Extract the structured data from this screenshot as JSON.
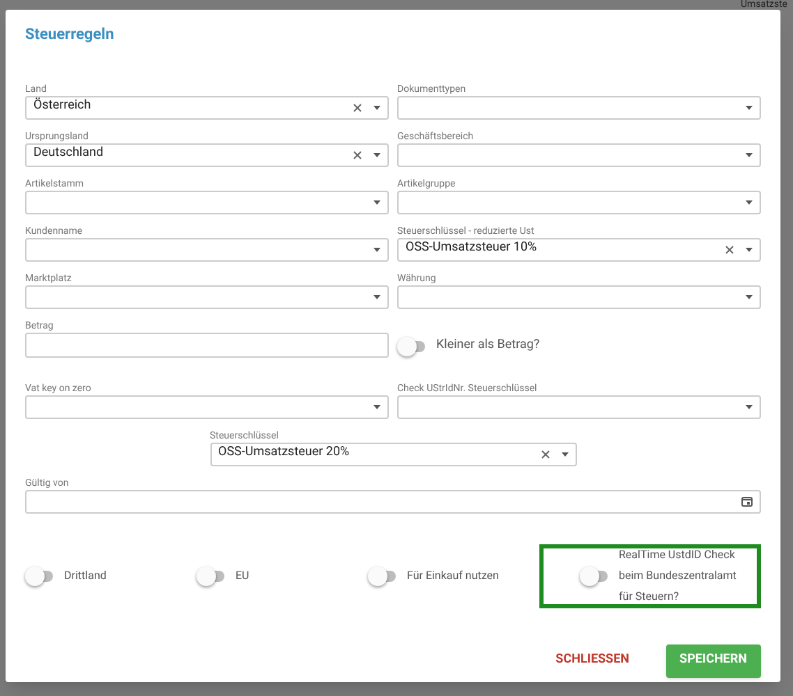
{
  "background_text": "Umsatzste",
  "title": "Steuerregeln",
  "sections": [
    {
      "rows": [
        [
          {
            "kind": "select",
            "label": "Land",
            "value": "Österreich",
            "clearable": true
          },
          {
            "kind": "select",
            "label": "Dokumenttypen",
            "clearable": false
          }
        ],
        [
          {
            "kind": "select",
            "label": "Ursprungsland",
            "value": "Deutschland",
            "clearable": true
          },
          {
            "kind": "select",
            "label": "Geschäftsbereich",
            "clearable": false
          }
        ],
        [
          {
            "kind": "select",
            "label": "Artikelstamm",
            "clearable": false
          },
          {
            "kind": "select",
            "label": "Artikelgruppe",
            "clearable": false
          }
        ],
        [
          {
            "kind": "select",
            "label": "Kundenname",
            "clearable": false
          },
          {
            "kind": "select",
            "label": "Steuerschlüssel - reduzierte Ust",
            "value": "OSS-Umsatzsteuer 10%",
            "clearable": true
          }
        ],
        [
          {
            "kind": "select",
            "label": "Marktplatz",
            "clearable": false
          },
          {
            "kind": "select",
            "label": "Währung",
            "clearable": false
          }
        ],
        [
          {
            "kind": "input",
            "label": "Betrag"
          },
          {
            "kind": "toggle",
            "label": "Kleiner als Betrag?",
            "on": false
          }
        ]
      ]
    },
    {
      "rows": [
        [
          {
            "kind": "select",
            "label": "Vat key on zero",
            "clearable": false
          },
          {
            "kind": "select",
            "label": "Check UStrIdNr. Steuerschlüssel",
            "clearable": false
          }
        ],
        [
          {
            "kind": "select",
            "label": "Steuerschlüssel",
            "value": "OSS-Umsatzsteuer 20%",
            "clearable": true
          }
        ],
        [
          {
            "kind": "date",
            "label": "Gültig von"
          }
        ]
      ]
    }
  ],
  "toggles": [
    {
      "label": "Drittland",
      "on": false,
      "highlighted": false
    },
    {
      "label": "EU",
      "on": false,
      "highlighted": false
    },
    {
      "label": "Für Einkauf nutzen",
      "on": false,
      "highlighted": false
    },
    {
      "label": "RealTime UstdID Check beim Bundeszentralamt für Steuern?",
      "on": false,
      "highlighted": true
    }
  ],
  "buttons": [
    {
      "label": "SCHLIESSEN",
      "kind": "text"
    },
    {
      "label": "SPEICHERN",
      "kind": "primary"
    }
  ]
}
